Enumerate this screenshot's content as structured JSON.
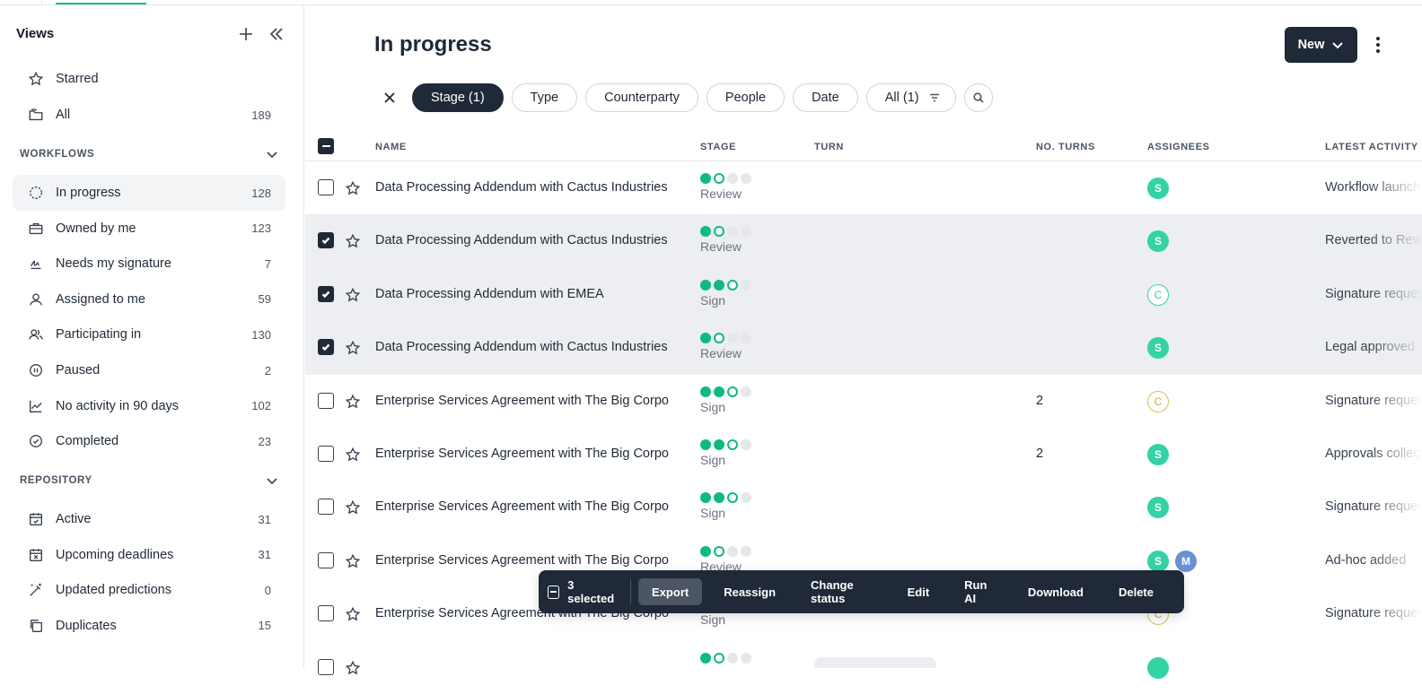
{
  "sidebar": {
    "title": "Views",
    "top_items": [
      {
        "label": "Starred",
        "count": "",
        "icon": "star-icon"
      },
      {
        "label": "All",
        "count": "189",
        "icon": "folder-icon"
      }
    ],
    "workflows_label": "WORKFLOWS",
    "workflow_items": [
      {
        "label": "In progress",
        "count": "128",
        "icon": "dashed-circle-icon",
        "active": true
      },
      {
        "label": "Owned by me",
        "count": "123",
        "icon": "briefcase-icon"
      },
      {
        "label": "Needs my signature",
        "count": "7",
        "icon": "signature-icon"
      },
      {
        "label": "Assigned to me",
        "count": "59",
        "icon": "user-icon"
      },
      {
        "label": "Participating in",
        "count": "130",
        "icon": "users-icon"
      },
      {
        "label": "Paused",
        "count": "2",
        "icon": "pause-icon"
      },
      {
        "label": "No activity in 90 days",
        "count": "102",
        "icon": "chart-line-icon"
      },
      {
        "label": "Completed",
        "count": "23",
        "icon": "check-circle-icon"
      }
    ],
    "repository_label": "REPOSITORY",
    "repository_items": [
      {
        "label": "Active",
        "count": "31",
        "icon": "calendar-check-icon"
      },
      {
        "label": "Upcoming deadlines",
        "count": "31",
        "icon": "calendar-x-icon"
      },
      {
        "label": "Updated predictions",
        "count": "0",
        "icon": "wand-icon"
      },
      {
        "label": "Duplicates",
        "count": "15",
        "icon": "duplicate-icon"
      }
    ]
  },
  "header": {
    "title": "In progress",
    "new_label": "New"
  },
  "filters": [
    "Stage (1)",
    "Type",
    "Counterparty",
    "People",
    "Date",
    "All (1)"
  ],
  "table": {
    "columns": {
      "name": "NAME",
      "stage": "STAGE",
      "turn": "TURN",
      "turns": "NO. TURNS",
      "assignees": "ASSIGNEES",
      "activity": "LATEST ACTIVITY"
    },
    "rows": [
      {
        "name": "Data Processing Addendum with Cactus Industries",
        "stage": "Review",
        "progress": [
          "done",
          "cur",
          "todo",
          "todo"
        ],
        "turns": "",
        "assignees": [
          {
            "t": "S",
            "k": "s"
          }
        ],
        "activity": "Workflow launched",
        "selected": false
      },
      {
        "name": "Data Processing Addendum with Cactus Industries",
        "stage": "Review",
        "progress": [
          "done",
          "cur",
          "todo",
          "todo"
        ],
        "turns": "",
        "assignees": [
          {
            "t": "S",
            "k": "s"
          }
        ],
        "activity": "Reverted to Review",
        "selected": true
      },
      {
        "name": "Data Processing Addendum with EMEA",
        "stage": "Sign",
        "progress": [
          "done",
          "done",
          "cur",
          "todo"
        ],
        "turns": "",
        "assignees": [
          {
            "t": "C",
            "k": "c-out"
          }
        ],
        "activity": "Signature requested",
        "selected": true
      },
      {
        "name": "Data Processing Addendum with Cactus Industries",
        "stage": "Review",
        "progress": [
          "done",
          "cur",
          "todo",
          "todo"
        ],
        "turns": "",
        "assignees": [
          {
            "t": "S",
            "k": "s"
          }
        ],
        "activity": "Legal approved",
        "selected": true
      },
      {
        "name": "Enterprise Services Agreement with The Big Corpo",
        "stage": "Sign",
        "progress": [
          "done",
          "done",
          "cur",
          "todo"
        ],
        "turns": "2",
        "assignees": [
          {
            "t": "C",
            "k": "c-yel"
          }
        ],
        "activity": "Signature requested",
        "selected": false
      },
      {
        "name": "Enterprise Services Agreement with The Big Corpo",
        "stage": "Sign",
        "progress": [
          "done",
          "done",
          "cur",
          "todo"
        ],
        "turns": "2",
        "assignees": [
          {
            "t": "S",
            "k": "s"
          }
        ],
        "activity": "Approvals collected",
        "selected": false
      },
      {
        "name": "Enterprise Services Agreement with The Big Corpo",
        "stage": "Sign",
        "progress": [
          "done",
          "done",
          "cur",
          "todo"
        ],
        "turns": "",
        "assignees": [
          {
            "t": "S",
            "k": "s"
          }
        ],
        "activity": "Signature requested",
        "selected": false
      },
      {
        "name": "Enterprise Services Agreement with The Big Corpo",
        "stage": "Review",
        "progress": [
          "done",
          "cur",
          "todo",
          "todo"
        ],
        "turns": "",
        "assignees": [
          {
            "t": "S",
            "k": "s"
          },
          {
            "t": "M",
            "k": "m"
          }
        ],
        "activity": "Ad-hoc added",
        "selected": false
      },
      {
        "name": "Enterprise Services Agreement with The Big Corpo",
        "stage": "Sign",
        "progress": [
          "done",
          "done",
          "cur",
          "todo"
        ],
        "turns": "",
        "assignees": [
          {
            "t": "C",
            "k": "c-yel"
          }
        ],
        "activity": "Signature requested",
        "selected": false
      },
      {
        "name": "",
        "stage": "",
        "progress": [
          "done",
          "cur",
          "todo",
          "todo"
        ],
        "turns": "",
        "assignees": [
          {
            "t": "",
            "k": "s"
          }
        ],
        "activity": "",
        "selected": false
      }
    ]
  },
  "action_bar": {
    "selected_label": "3 selected",
    "actions": [
      "Export",
      "Reassign",
      "Change status",
      "Edit",
      "Run AI",
      "Download",
      "Delete"
    ]
  }
}
